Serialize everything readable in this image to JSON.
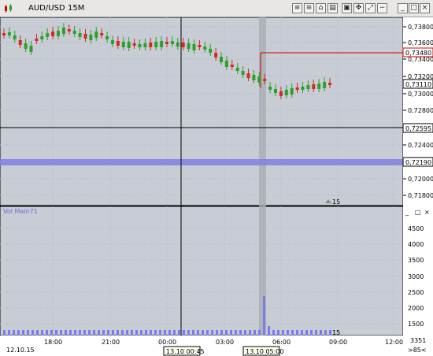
{
  "window": {
    "symbol": "AUD/USD",
    "timeframe": "15M",
    "toolbar_icons": [
      "list-icon",
      "list-icon",
      "building-icon",
      "document-icon",
      "window-icon",
      "move-icon",
      "expand-icon",
      "minus-box-icon",
      "minimize-icon",
      "maximize-icon",
      "close-icon"
    ]
  },
  "price_panel": {
    "y_labels": [
      "0,73800",
      "0,73600",
      "0,73400",
      "0,73200",
      "0,73000",
      "0,72800",
      "0,72600",
      "0,72400",
      "0,72200",
      "0,72000",
      "0,71800"
    ],
    "highlight_labels": {
      "level_red": "0,73480",
      "current": "0,73110",
      "crosshair": "0,72595",
      "band": "0,72190"
    },
    "bar_count": "15"
  },
  "volume_panel": {
    "title": "Vol  Main71",
    "y_labels": [
      "4500",
      "4000",
      "3500",
      "3000",
      "2500",
      "2000",
      "1500"
    ],
    "bar_count": "15",
    "controls": [
      "minimize-icon",
      "maximize-icon",
      "close-icon"
    ]
  },
  "time_axis": {
    "labels": [
      "18:00",
      "21:00",
      "00:00",
      "03:00",
      "06:00",
      "09:00",
      "12:00"
    ],
    "start_date": "12.10.15",
    "crosshair_time": "13.10 00:45",
    "highlight_time": "13.10 05:00",
    "counter": "3351",
    "counter2": ">85<"
  },
  "colors": {
    "bull": "#2ca02c",
    "bear": "#d62728",
    "red_line": "#cc0000",
    "band": "#8080e0",
    "volume": "#7c7ce8"
  }
}
